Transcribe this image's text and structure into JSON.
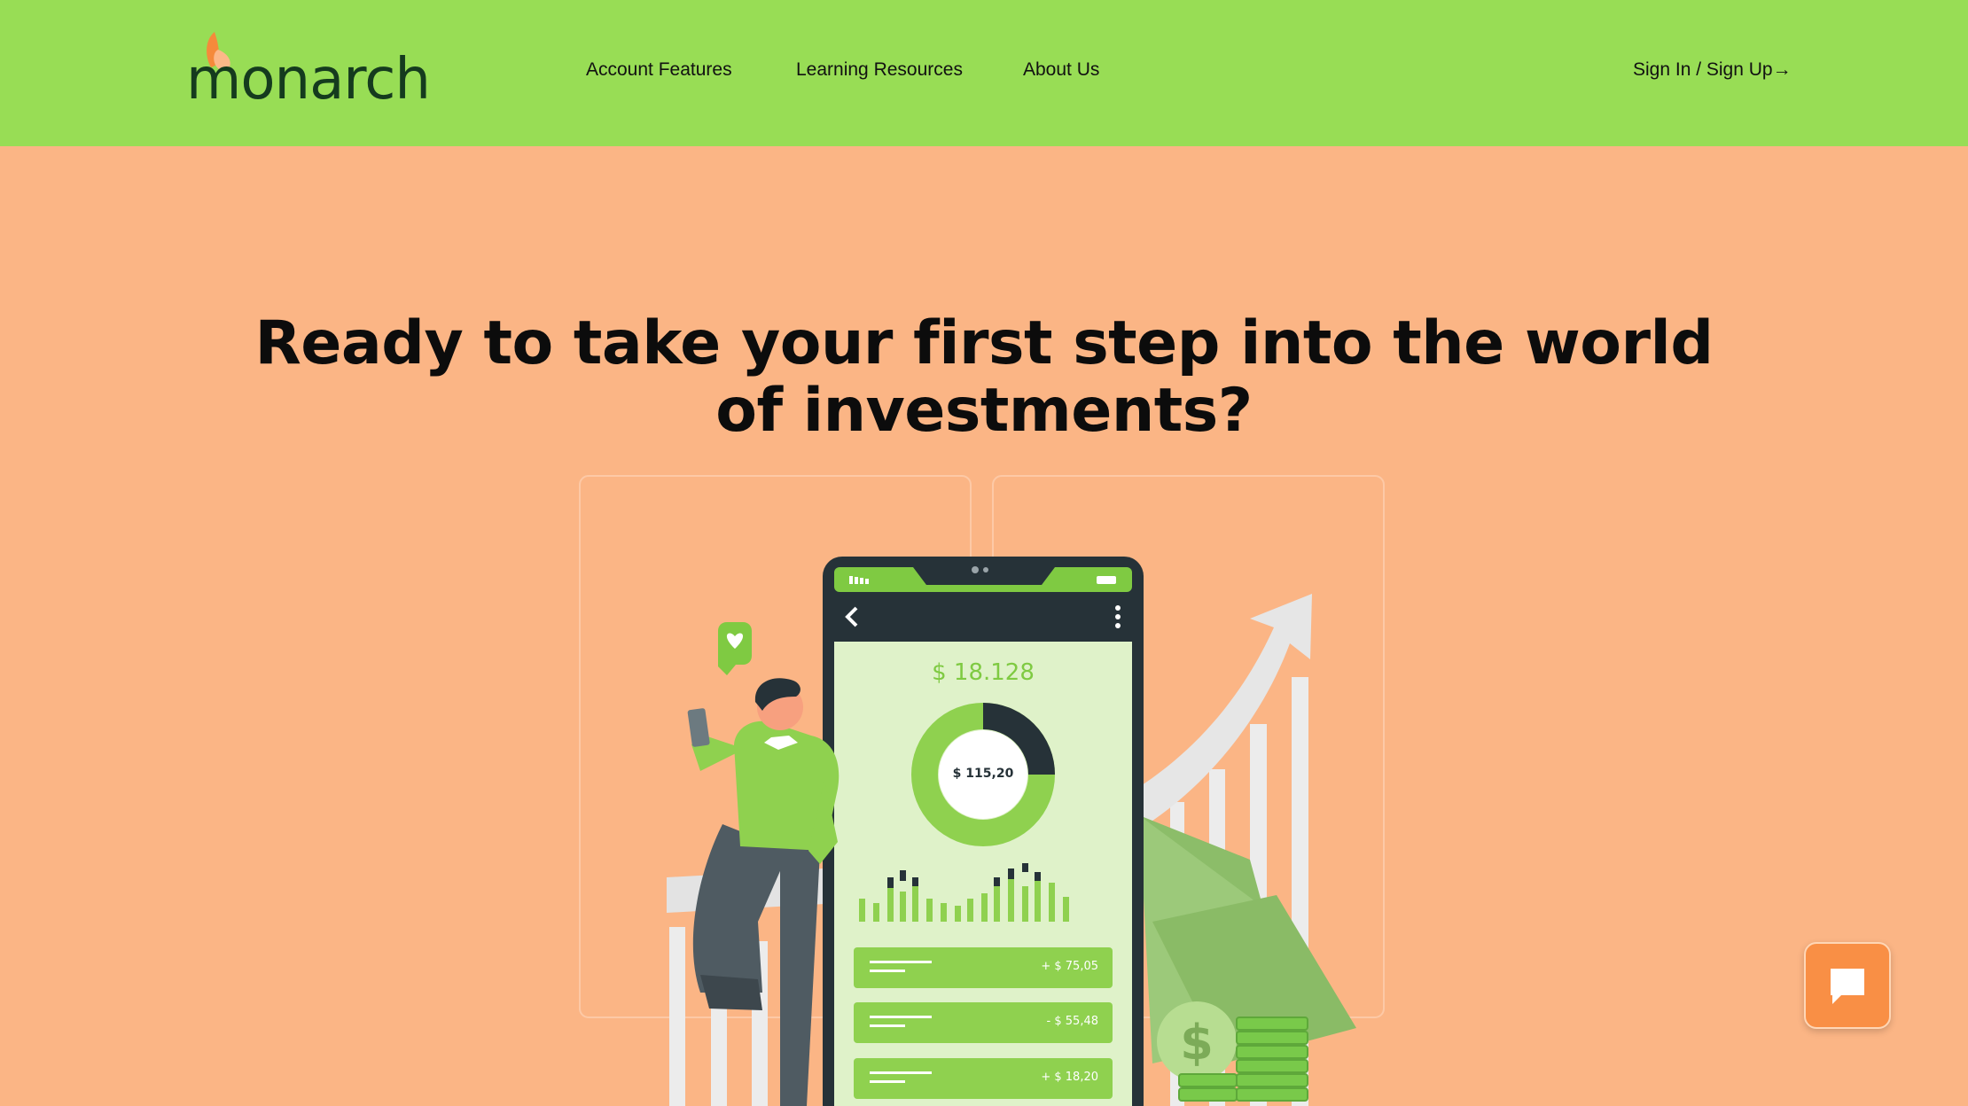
{
  "brand": {
    "name": "monarch"
  },
  "nav": {
    "links": [
      "Account Features",
      "Learning Resources",
      "About Us"
    ],
    "signin_label": "Sign In / Sign Up→"
  },
  "hero": {
    "title": "Ready to take your first step into the world of investments?"
  },
  "illustration": {
    "balance": "$ 18.128",
    "donut_center": "$ 115,20",
    "donut_fraction": 0.75,
    "transactions": [
      {
        "amount": "+ $ 75,05"
      },
      {
        "amount": "- $ 55,48"
      },
      {
        "amount": "+ $ 18,20"
      }
    ]
  },
  "colors": {
    "nav_bg": "#98dd55",
    "page_bg": "#fbb585",
    "accent_green": "#8fd14f",
    "phone_dark": "#263238",
    "chat_orange": "#f98f45"
  },
  "icons": {
    "logo_wing": "butterfly-wing-icon",
    "chat": "chat-bubble-icon",
    "back": "chevron-left-icon",
    "menu": "more-vertical-icon"
  }
}
